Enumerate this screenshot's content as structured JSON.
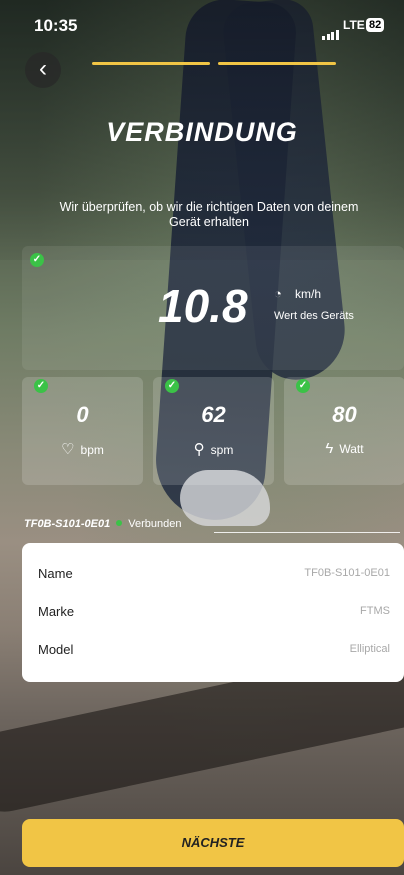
{
  "status_bar": {
    "time": "10:35",
    "network": "LTE",
    "battery": "82"
  },
  "header": {
    "title": "VERBINDUNG",
    "subtitle": "Wir überprüfen, ob wir die richtigen Daten von deinem Gerät erhalten",
    "progress_steps_total": 2,
    "progress_steps_complete": 2
  },
  "speed": {
    "value": "10.8",
    "unit": "km/h",
    "subtitle": "Wert des Geräts",
    "icon": "speedometer-icon"
  },
  "metrics": [
    {
      "value": "0",
      "unit": "bpm",
      "icon": "heart-icon"
    },
    {
      "value": "62",
      "unit": "spm",
      "icon": "footsteps-icon"
    },
    {
      "value": "80",
      "unit": "Watt",
      "icon": "lightning-icon"
    }
  ],
  "device": {
    "id": "TF0B-S101-0E01",
    "status": "Verbunden",
    "status_color": "#3bc247",
    "rows": [
      {
        "label": "Name",
        "value": "TF0B-S101-0E01"
      },
      {
        "label": "Marke",
        "value": "FTMS"
      },
      {
        "label": "Model",
        "value": "Elliptical"
      }
    ]
  },
  "footer": {
    "next_label": "NÄCHSTE"
  },
  "colors": {
    "accent": "#f1c545",
    "check": "#3bc247"
  }
}
